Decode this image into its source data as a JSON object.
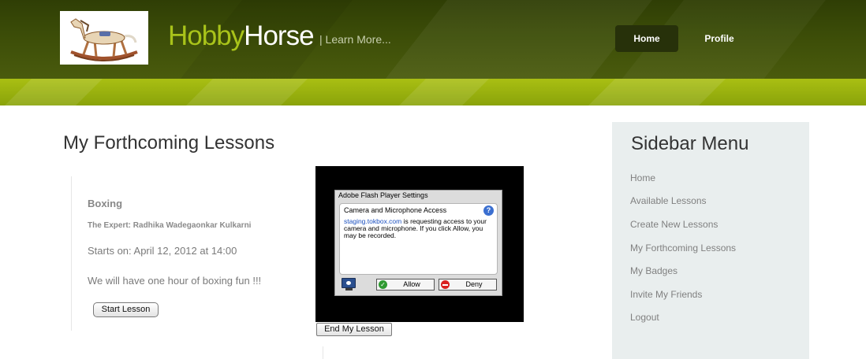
{
  "header": {
    "brand_hobby": "Hobby",
    "brand_horse": "Horse",
    "tagline": "| Learn More...",
    "nav": {
      "home": "Home",
      "profile": "Profile"
    },
    "colors": {
      "dark": "#3c4d08",
      "accent": "#a9c31a",
      "nav_active": "#27310a"
    }
  },
  "main": {
    "title": "My Forthcoming Lessons",
    "lesson": {
      "name": "Boxing",
      "expert": "The Expert: Radhika Wadegaonkar Kulkarni",
      "starts": "Starts on: April 12, 2012 at 14:00",
      "description": "We will have one hour of boxing fun !!!",
      "start_button": "Start Lesson"
    },
    "end_button": "End My Lesson"
  },
  "flash": {
    "title": "Adobe Flash Player Settings",
    "heading": "Camera and Microphone Access",
    "help": "?",
    "link": "staging.tokbox.com",
    "message": " is requesting access to your camera and microphone. If you click Allow, you may be recorded.",
    "allow": "Allow",
    "deny": "Deny",
    "check": "✓"
  },
  "sidebar": {
    "title": "Sidebar Menu",
    "items": [
      "Home",
      "Available Lessons",
      "Create New Lessons",
      "My Forthcoming Lessons",
      "My Badges",
      "Invite My Friends",
      "Logout"
    ]
  }
}
